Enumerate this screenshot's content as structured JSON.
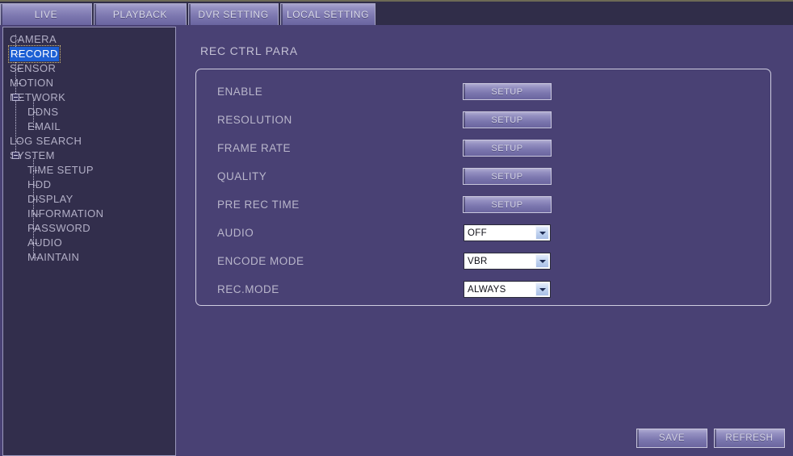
{
  "window": {
    "background_color": "#494174",
    "sidebar_color": "#322e4c",
    "accent_color": "#1c5fd4"
  },
  "tabs": [
    {
      "id": "live",
      "label": "LIVE",
      "active": false
    },
    {
      "id": "playback",
      "label": "PLAYBACK",
      "active": false
    },
    {
      "id": "dvr-setting",
      "label": "DVR SETTING",
      "active": true
    },
    {
      "id": "local-setting",
      "label": "LOCAL SETTING",
      "active": false
    }
  ],
  "sidebar": {
    "items": [
      {
        "label": "CAMERA",
        "level": 0,
        "expander": "none",
        "selected": false
      },
      {
        "label": "RECORD",
        "level": 0,
        "expander": "none",
        "selected": true
      },
      {
        "label": "SENSOR",
        "level": 0,
        "expander": "none",
        "selected": false
      },
      {
        "label": "MOTION",
        "level": 0,
        "expander": "none",
        "selected": false
      },
      {
        "label": "NETWORK",
        "level": 0,
        "expander": "minus",
        "selected": false
      },
      {
        "label": "DDNS",
        "level": 1,
        "expander": "none",
        "selected": false
      },
      {
        "label": "EMAIL",
        "level": 1,
        "expander": "none",
        "selected": false
      },
      {
        "label": "LOG SEARCH",
        "level": 0,
        "expander": "none",
        "selected": false
      },
      {
        "label": "SYSTEM",
        "level": 0,
        "expander": "minus",
        "selected": false
      },
      {
        "label": "TIME SETUP",
        "level": 1,
        "expander": "none",
        "selected": false
      },
      {
        "label": "HDD",
        "level": 1,
        "expander": "none",
        "selected": false
      },
      {
        "label": "DISPLAY",
        "level": 1,
        "expander": "none",
        "selected": false
      },
      {
        "label": "INFORMATION",
        "level": 1,
        "expander": "none",
        "selected": false
      },
      {
        "label": "PASSWORD",
        "level": 1,
        "expander": "none",
        "selected": false
      },
      {
        "label": "AUDIO",
        "level": 1,
        "expander": "none",
        "selected": false
      },
      {
        "label": "MAINTAIN",
        "level": 1,
        "expander": "none",
        "selected": false
      }
    ]
  },
  "main": {
    "title": "REC CTRL PARA",
    "rows": [
      {
        "label": "ENABLE",
        "control": "button",
        "value": "SETUP"
      },
      {
        "label": "RESOLUTION",
        "control": "button",
        "value": "SETUP"
      },
      {
        "label": "FRAME RATE",
        "control": "button",
        "value": "SETUP"
      },
      {
        "label": "QUALITY",
        "control": "button",
        "value": "SETUP"
      },
      {
        "label": "PRE REC TIME",
        "control": "button",
        "value": "SETUP"
      },
      {
        "label": "AUDIO",
        "control": "select",
        "value": "OFF"
      },
      {
        "label": "ENCODE MODE",
        "control": "select",
        "value": "VBR"
      },
      {
        "label": "REC.MODE",
        "control": "select",
        "value": "ALWAYS"
      }
    ]
  },
  "footer": {
    "buttons": [
      {
        "id": "save",
        "label": "SAVE"
      },
      {
        "id": "refresh",
        "label": "REFRESH"
      }
    ]
  }
}
